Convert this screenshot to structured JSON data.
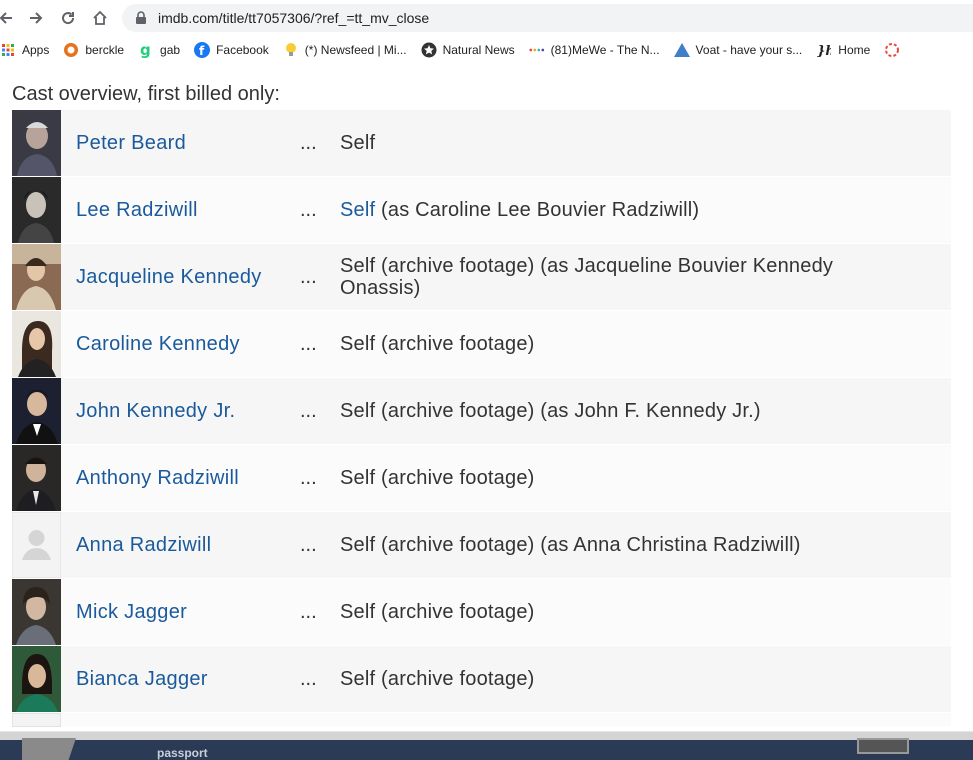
{
  "browser": {
    "url": "imdb.com/title/tt7057306/?ref_=tt_mv_close",
    "bookmarks": [
      {
        "label": "Apps",
        "icon": "apps-grid-icon"
      },
      {
        "label": "berckle",
        "icon": "berckle-icon"
      },
      {
        "label": "gab",
        "icon": "gab-icon"
      },
      {
        "label": "Facebook",
        "icon": "facebook-icon"
      },
      {
        "label": "(*) Newsfeed | Mi...",
        "icon": "lightbulb-icon"
      },
      {
        "label": "Natural News",
        "icon": "natural-news-icon"
      },
      {
        "label": "(81)MeWe - The N...",
        "icon": "mewe-icon"
      },
      {
        "label": "Voat - have your s...",
        "icon": "voat-icon"
      },
      {
        "label": "Home",
        "icon": "home-bookmark-icon"
      }
    ]
  },
  "page": {
    "heading": "Cast overview, first billed only:",
    "ellipsis": "...",
    "cast": [
      {
        "name": "Peter Beard",
        "character": "Self",
        "character_link": "",
        "note": ""
      },
      {
        "name": "Lee Radziwill",
        "character": "",
        "character_link": "Self",
        "note": " (as Caroline Lee Bouvier Radziwill)"
      },
      {
        "name": "Jacqueline Kennedy",
        "character": "Self (archive footage) (as Jacqueline Bouvier Kennedy Onassis)",
        "character_link": "",
        "note": ""
      },
      {
        "name": "Caroline Kennedy",
        "character": "Self (archive footage)",
        "character_link": "",
        "note": ""
      },
      {
        "name": "John Kennedy Jr.",
        "character": "Self (archive footage) (as John F. Kennedy Jr.)",
        "character_link": "",
        "note": ""
      },
      {
        "name": "Anthony Radziwill",
        "character": "Self (archive footage)",
        "character_link": "",
        "note": ""
      },
      {
        "name": "Anna Radziwill",
        "character": "Self (archive footage) (as Anna Christina Radziwill)",
        "character_link": "",
        "note": ""
      },
      {
        "name": "Mick Jagger",
        "character": "Self (archive footage)",
        "character_link": "",
        "note": ""
      },
      {
        "name": "Bianca Jagger",
        "character": "Self (archive footage)",
        "character_link": "",
        "note": ""
      }
    ]
  },
  "footer": {
    "text": "passport"
  }
}
